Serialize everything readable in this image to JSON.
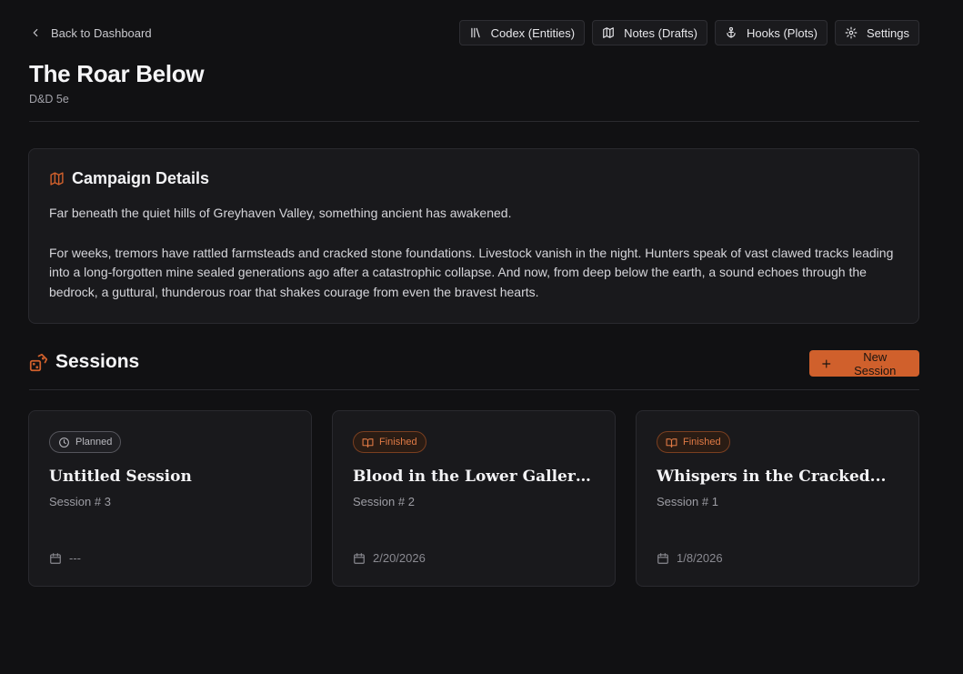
{
  "topbar": {
    "back_label": "Back to Dashboard",
    "nav": [
      {
        "label": "Codex (Entities)",
        "icon": "library-icon"
      },
      {
        "label": "Notes (Drafts)",
        "icon": "map-icon"
      },
      {
        "label": "Hooks (Plots)",
        "icon": "anchor-icon"
      },
      {
        "label": "Settings",
        "icon": "gear-icon"
      }
    ]
  },
  "campaign": {
    "title": "The Roar Below",
    "system": "D&D 5e"
  },
  "details": {
    "title": "Campaign Details",
    "paragraph1": "Far beneath the quiet hills of Greyhaven Valley, something ancient has awakened.",
    "paragraph2": "For weeks, tremors have rattled farmsteads and cracked stone foundations. Livestock vanish in the night. Hunters speak of vast clawed tracks leading into a long-forgotten mine sealed generations ago after a catastrophic collapse. And now, from deep below the earth, a sound echoes through the bedrock, a guttural, thunderous roar that shakes courage from even the bravest hearts."
  },
  "sessions": {
    "title": "Sessions",
    "new_label": "New Session",
    "items": [
      {
        "status": "Planned",
        "title": "Untitled Session",
        "number": "Session # 3",
        "date": "---"
      },
      {
        "status": "Finished",
        "title": "Blood in the Lower Galleries",
        "number": "Session # 2",
        "date": "2/20/2026"
      },
      {
        "status": "Finished",
        "title": "Whispers in the Cracked...",
        "number": "Session # 1",
        "date": "1/8/2026"
      }
    ]
  },
  "colors": {
    "accent": "#d0602c",
    "background": "#111113",
    "card": "#19191c"
  }
}
